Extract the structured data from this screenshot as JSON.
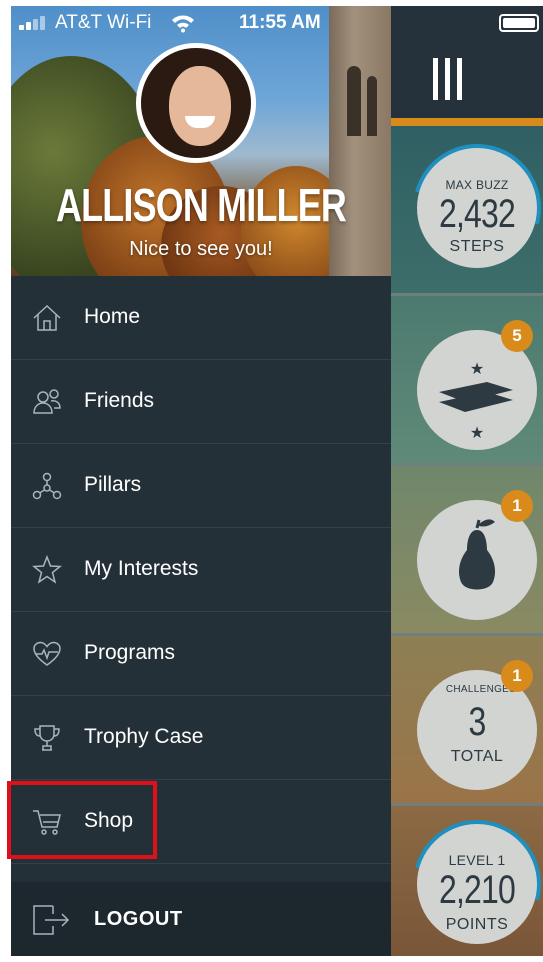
{
  "status_bar": {
    "carrier": "AT&T Wi-Fi",
    "time": "11:55 AM"
  },
  "profile": {
    "name": "ALLISON MILLER",
    "greeting": "Nice to see you!"
  },
  "menu": {
    "items": [
      {
        "label": "Home",
        "icon": "home-icon"
      },
      {
        "label": "Friends",
        "icon": "friends-icon"
      },
      {
        "label": "Pillars",
        "icon": "pillars-icon"
      },
      {
        "label": "My Interests",
        "icon": "star-icon"
      },
      {
        "label": "Programs",
        "icon": "heart-pulse-icon"
      },
      {
        "label": "Trophy Case",
        "icon": "trophy-icon"
      },
      {
        "label": "Shop",
        "icon": "cart-icon"
      }
    ],
    "logout_label": "LOGOUT"
  },
  "panel": {
    "max_buzz": {
      "title": "MAX BUZZ",
      "value": "2,432",
      "unit": "STEPS"
    },
    "pillars": {
      "badge": "5"
    },
    "nutrition": {
      "badge": "1",
      "icon": "pear-icon"
    },
    "challenges": {
      "title": "CHALLENGES",
      "value": "3",
      "unit": "TOTAL",
      "badge": "1"
    },
    "level": {
      "title": "LEVEL 1",
      "value": "2,210",
      "unit": "POINTS"
    }
  },
  "colors": {
    "drawer_bg": "#243038",
    "accent": "#d88a1b",
    "progress_ring": "#1e8fbf",
    "highlight_box": "#e0101a"
  }
}
